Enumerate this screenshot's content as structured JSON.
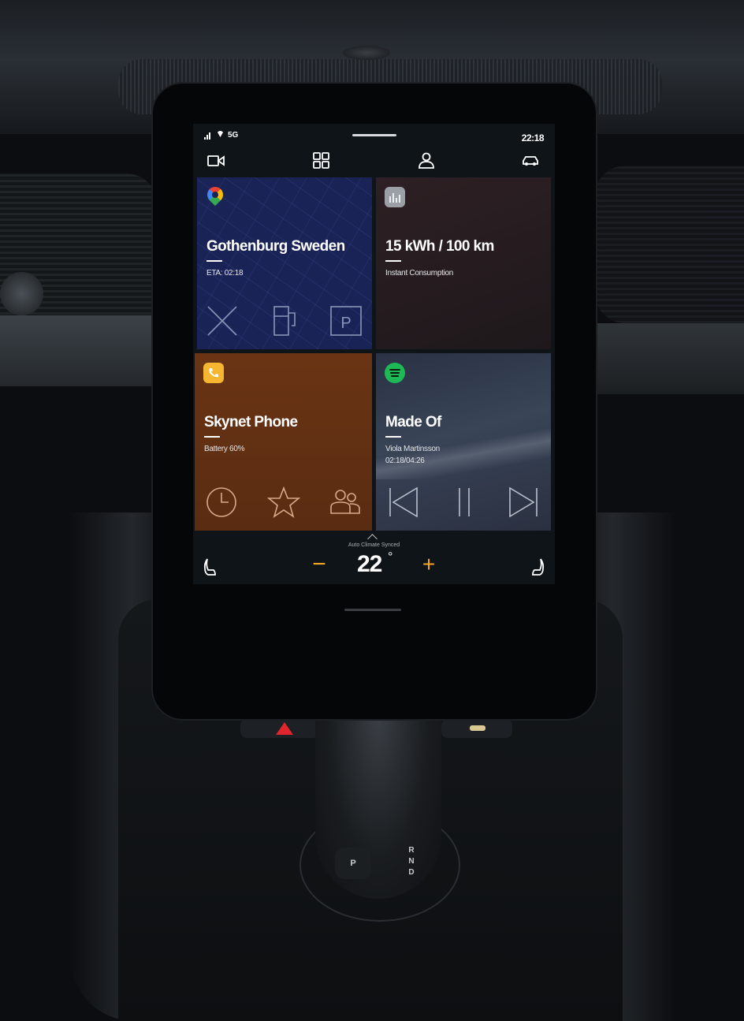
{
  "status_bar": {
    "network": "5G",
    "time": "22:18"
  },
  "top_icons": [
    "camera-icon",
    "apps-grid-icon",
    "profile-icon",
    "car-icon"
  ],
  "tiles": {
    "navigation": {
      "app_icon": "google-maps-icon",
      "title": "Gothenburg Sweden",
      "subtitle": "ETA: 02:18",
      "actions": [
        "close-icon",
        "fuel-station-icon",
        "parking-icon"
      ],
      "parking_letter": "P"
    },
    "energy": {
      "app_icon": "energy-stats-icon",
      "title": "15 kWh / 100 km",
      "subtitle": "Instant Consumption"
    },
    "phone": {
      "app_icon": "phone-icon",
      "title": "Skynet Phone",
      "subtitle": "Battery 60%",
      "actions": [
        "recents-clock-icon",
        "favorites-star-icon",
        "contacts-icon"
      ]
    },
    "music": {
      "app_icon": "spotify-icon",
      "title": "Made Of",
      "artist": "Viola Martinsson",
      "progress": "02:18/04:26",
      "actions": [
        "previous-track-icon",
        "pause-icon",
        "next-track-icon"
      ]
    }
  },
  "climate": {
    "label": "Auto Climate Synced",
    "temperature": "22",
    "unit": "°",
    "decrease": "−",
    "increase": "+"
  },
  "console": {
    "gear_park": "P",
    "gear_letters": [
      "R",
      "N",
      "D"
    ]
  },
  "colors": {
    "accent": "#f5a623",
    "nav_tile": "#1a2356",
    "phone_tile": "#6a3414",
    "spotify": "#1db954"
  }
}
